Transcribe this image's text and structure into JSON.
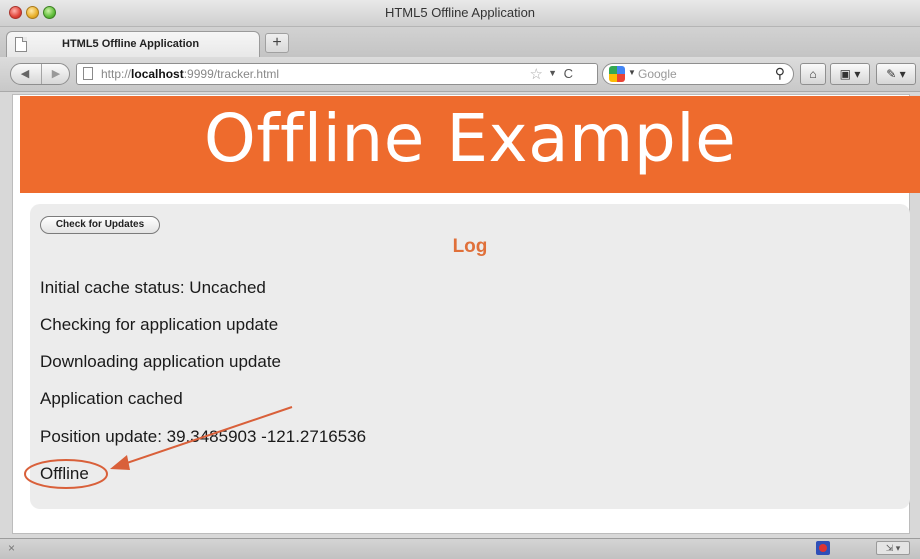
{
  "window": {
    "title": "HTML5 Offline Application"
  },
  "tabs": [
    {
      "label": "HTML5 Offline Application",
      "active": true
    }
  ],
  "toolbar": {
    "new_tab_label": "+",
    "back_label": "◀",
    "forward_label": "▶",
    "url_prefix": "http://",
    "url_host": "localhost",
    "url_rest": ":9999/tracker.html",
    "reload_label": "C",
    "search_placeholder": "Google",
    "home_label": "⌂",
    "bookmarks_label": "▣ ▾",
    "addons_label": "✎ ▾"
  },
  "page": {
    "banner_title": "Offline Example",
    "banner_color": "#ee6b2d",
    "check_updates_label": "Check for Updates",
    "log_heading": "Log",
    "log_lines": [
      "Initial cache status: Uncached",
      "Checking for application update",
      "Downloading application update",
      "Application cached",
      "Position update: 39.3485903 -121.2716536",
      "Offline"
    ]
  },
  "annotation": {
    "color": "#d9603a",
    "circled_item": "Offline"
  },
  "statusbar": {
    "close_label": "×",
    "resize_label": "⇲ ▾"
  }
}
